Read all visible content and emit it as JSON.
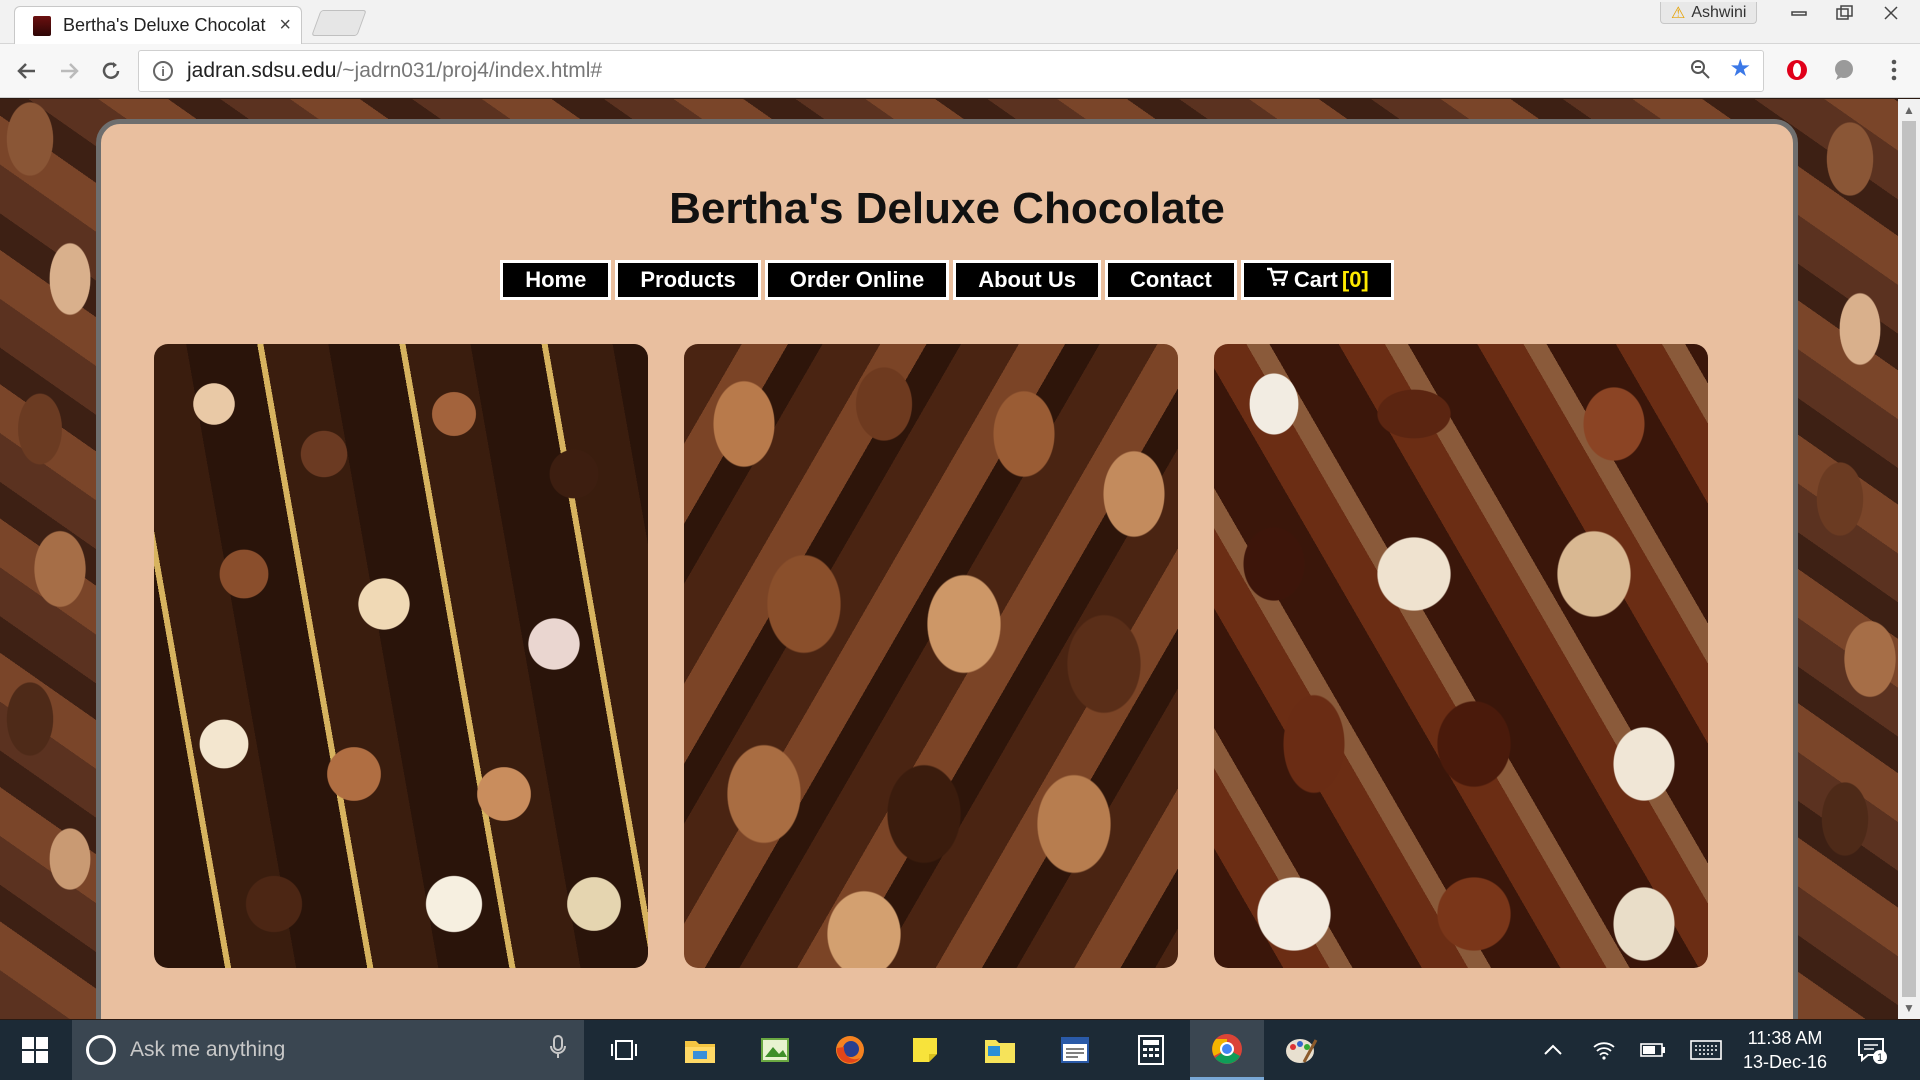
{
  "browser": {
    "tab_title": "Bertha's Deluxe Chocolat",
    "tab_close": "×",
    "profile_name": "Ashwini",
    "url_host": "jadran.sdsu.edu",
    "url_path": "/~jadrn031/proj4/index.html#"
  },
  "site": {
    "title": "Bertha's Deluxe Chocolate",
    "nav": {
      "home": "Home",
      "products": "Products",
      "order_online": "Order Online",
      "about_us": "About Us",
      "contact": "Contact",
      "cart_label": "Cart",
      "cart_count": "[0]"
    }
  },
  "taskbar": {
    "search_placeholder": "Ask me anything",
    "time": "11:38 AM",
    "date": "13-Dec-16",
    "notification_count": "1"
  },
  "colors": {
    "container_bg": "#e9bf9f",
    "nav_bg": "#000000",
    "cart_count": "#ffea00",
    "taskbar_bg": "#1c2a36"
  }
}
